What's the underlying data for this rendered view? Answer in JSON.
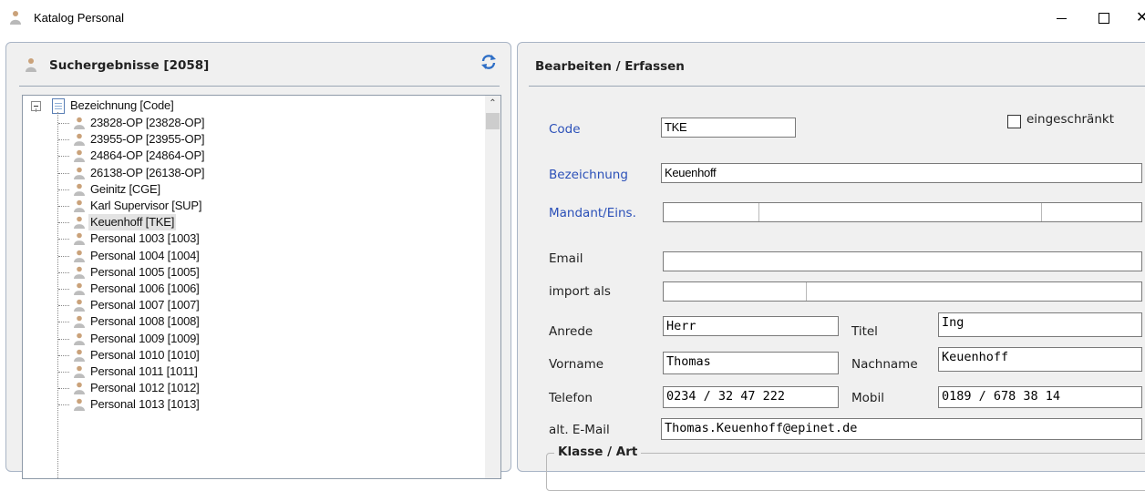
{
  "window": {
    "title": "Katalog Personal",
    "icon": "person-icon",
    "controls": [
      "minimize",
      "maximize",
      "close"
    ]
  },
  "left_panel": {
    "title": "Suchergebnisse [2058]",
    "refresh_icon": "refresh-icon",
    "tree": {
      "root_label": "Bezeichnung [Code]",
      "items": [
        "23828-OP [23828-OP]",
        "23955-OP [23955-OP]",
        "24864-OP [24864-OP]",
        "26138-OP [26138-OP]",
        "Geinitz [CGE]",
        "Karl Supervisor [SUP]",
        "Keuenhoff [TKE]",
        "Personal 1003 [1003]",
        "Personal 1004 [1004]",
        "Personal 1005 [1005]",
        "Personal 1006 [1006]",
        "Personal 1007 [1007]",
        "Personal 1008 [1008]",
        "Personal 1009 [1009]",
        "Personal 1010 [1010]",
        "Personal 1011 [1011]",
        "Personal 1012 [1012]",
        "Personal 1013 [1013]"
      ],
      "selected_index": 6
    }
  },
  "right_panel": {
    "title": "Bearbeiten / Erfassen",
    "fields": {
      "code": {
        "label": "Code",
        "value": "TKE"
      },
      "restricted": {
        "label": "eingeschränkt",
        "checked": false
      },
      "bezeichnung": {
        "label": "Bezeichnung",
        "value": "Keuenhoff"
      },
      "mandant": {
        "label": "Mandant/Eins.",
        "value": ""
      },
      "email": {
        "label": "Email",
        "value": ""
      },
      "import_als": {
        "label": "import als",
        "value": ""
      },
      "anrede": {
        "label": "Anrede",
        "value": "Herr"
      },
      "titel": {
        "label": "Titel",
        "value": "Ing"
      },
      "vorname": {
        "label": "Vorname",
        "value": "Thomas"
      },
      "nachname": {
        "label": "Nachname",
        "value": "Keuenhoff"
      },
      "telefon": {
        "label": "Telefon",
        "value": "0234 / 32 47 222"
      },
      "mobil": {
        "label": "Mobil",
        "value": "0189 / 678 38 14"
      },
      "alt_email": {
        "label": "alt. E-Mail",
        "value": "Thomas.Keuenhoff@epinet.de"
      }
    },
    "group_title": "Klasse / Art"
  }
}
